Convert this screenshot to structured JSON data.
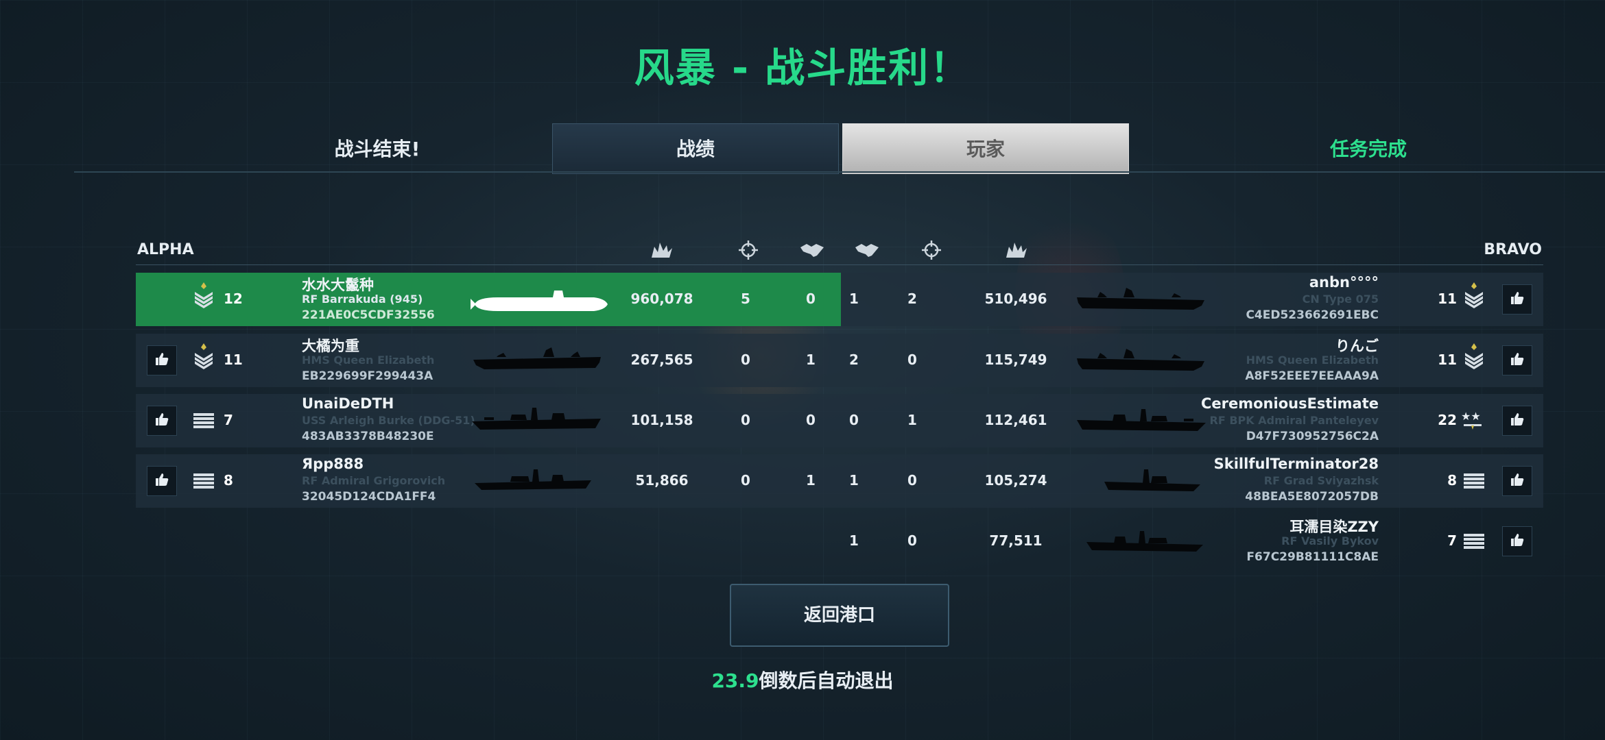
{
  "title": "风暴 - 战斗胜利！",
  "battle_over": "战斗结束!",
  "tabs": [
    {
      "label": "战绩",
      "active": false
    },
    {
      "label": "玩家",
      "active": true
    }
  ],
  "mission_complete": "任务完成",
  "teams": {
    "left": "ALPHA",
    "right": "BRAVO"
  },
  "column_icons": [
    "damage-icon",
    "crosshair-icon",
    "handshake-icon",
    "handshake-icon",
    "crosshair-icon",
    "damage-icon"
  ],
  "alpha": [
    {
      "name": "水水大鬣种",
      "ship": "RF Barrakuda (945)",
      "id": "221AE0C5CDF32556",
      "rank": "12",
      "damage": "960,078",
      "kills": "5",
      "assists": "0",
      "highlight": true,
      "like": false,
      "ship_type": "submarine"
    },
    {
      "name": "大橘为重",
      "ship": "HMS Queen Elizabeth",
      "id": "EB229699F299443A",
      "rank": "11",
      "damage": "267,565",
      "kills": "0",
      "assists": "1",
      "highlight": false,
      "like": true,
      "ship_type": "carrier"
    },
    {
      "name": "UnaiDeDTH",
      "ship": "USS Arleigh Burke (DDG-51)",
      "id": "483AB3378B48230E",
      "rank": "7",
      "damage": "101,158",
      "kills": "0",
      "assists": "0",
      "highlight": false,
      "like": true,
      "ship_type": "destroyer"
    },
    {
      "name": "Ярр888",
      "ship": "RF Admiral Grigorovich",
      "id": "32045D124CDA1FF4",
      "rank": "8",
      "damage": "51,866",
      "kills": "0",
      "assists": "1",
      "highlight": false,
      "like": true,
      "ship_type": "frigate"
    }
  ],
  "bravo": [
    {
      "name": "anbn°°°°",
      "ship": "CN Type 075",
      "id": "C4ED523662691EBC",
      "rank": "11",
      "assists": "1",
      "kills": "2",
      "damage": "510,496",
      "ship_type": "carrier"
    },
    {
      "name": "りんご",
      "ship": "HMS Queen Elizabeth",
      "id": "A8F52EEE7EEAAA9A",
      "rank": "11",
      "assists": "2",
      "kills": "0",
      "damage": "115,749",
      "ship_type": "carrier"
    },
    {
      "name": "CeremoniousEstimate",
      "ship": "RF BPK Admiral Panteleyev",
      "id": "D47F730952756C2A",
      "rank": "22",
      "assists": "0",
      "kills": "1",
      "damage": "112,461",
      "ship_type": "destroyer"
    },
    {
      "name": "SkillfulTerminator28",
      "ship": "RF Grad Sviyazhsk",
      "id": "48BEA5E8072057DB",
      "rank": "8",
      "assists": "1",
      "kills": "0",
      "damage": "105,274",
      "ship_type": "corvette"
    },
    {
      "name": "耳濡目染ZZY",
      "ship": "RF Vasily Bykov",
      "id": "F67C29B81111C8AE",
      "rank": "7",
      "assists": "1",
      "kills": "0",
      "damage": "77,511",
      "ship_type": "frigate"
    }
  ],
  "return_button": "返回港口",
  "countdown": {
    "value": "23.9",
    "text": "倒数后自动退出"
  },
  "colors": {
    "accent_green": "#27d98a",
    "highlight_row": "#1e8a4a",
    "background": "#16242e"
  }
}
